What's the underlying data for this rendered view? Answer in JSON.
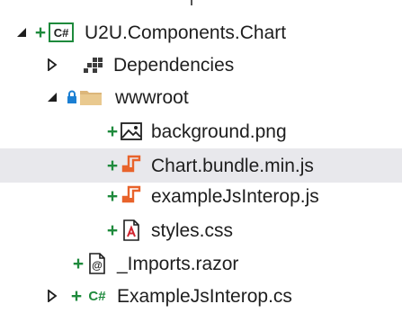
{
  "tree": {
    "project": {
      "name": "U2U.Components.Chart",
      "icon": "csharp-project-icon"
    },
    "dependencies": {
      "name": "Dependencies",
      "icon": "dependencies-icon"
    },
    "wwwroot": {
      "name": "wwwroot",
      "icon": "folder-icon"
    },
    "files": [
      {
        "name": "background.png",
        "icon": "image-file-icon"
      },
      {
        "name": "Chart.bundle.min.js",
        "icon": "js-file-icon"
      },
      {
        "name": "exampleJsInterop.js",
        "icon": "js-file-icon"
      },
      {
        "name": "styles.css",
        "icon": "css-file-icon"
      }
    ],
    "imports": {
      "name": "_Imports.razor",
      "icon": "razor-file-icon"
    },
    "interop_cs": {
      "name": "ExampleJsInterop.cs",
      "icon": "csharp-file-icon"
    }
  },
  "colors": {
    "selection": "#e8e8ec",
    "added_marker": "#1e8a3c",
    "js_icon": "#e8632b",
    "folder": "#dcb67a",
    "lock": "#1b7fd3"
  }
}
